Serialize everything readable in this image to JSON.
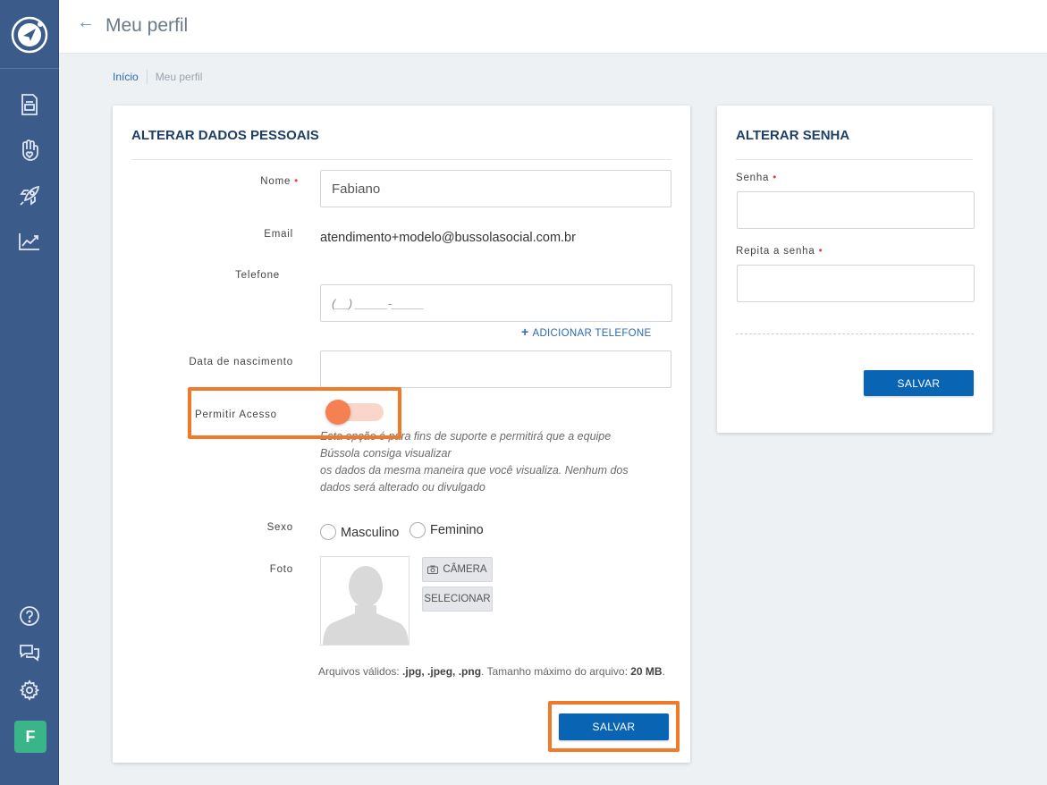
{
  "header": {
    "title": "Meu perfil"
  },
  "breadcrumb": {
    "home": "Início",
    "current": "Meu perfil"
  },
  "sidebar": {
    "items": [
      "document-icon",
      "hand-heart-icon",
      "rocket-icon",
      "chart-icon"
    ],
    "bottom": [
      "help-icon",
      "chat-icon",
      "gear-icon"
    ],
    "avatar_initial": "F",
    "avatar_color": "#3ab58a"
  },
  "personal": {
    "title": "ALTERAR DADOS PESSOAIS",
    "name_label": "Nome",
    "required_mark": "•",
    "name_value": "Fabiano",
    "email_label": "Email",
    "email_value": "atendimento+modelo@bussolasocial.com.br",
    "phone_label": "Telefone",
    "phone_placeholder": "(__) _____-_____",
    "add_phone": "ADICIONAR TELEFONE",
    "birth_label": "Data de nascimento",
    "birth_value": "",
    "access_label": "Permitir Acesso",
    "access_enabled": true,
    "access_help": [
      "Esta opção é para fins de suporte e permitirá que a equipe",
      "Bússola consiga visualizar",
      "os dados da mesma maneira que você visualiza. Nenhum dos",
      "dados será alterado ou divulgado"
    ],
    "sex_label": "Sexo",
    "sex_options": [
      "Masculino",
      "Feminino"
    ],
    "photo_label": "Foto",
    "camera_button": "CÂMERA",
    "select_button": "SELECIONAR",
    "file_note_prefix": "Arquivos válidos: ",
    "file_types": ".jpg, .jpeg, .png",
    "file_note_mid": ". Tamanho máximo do arquivo: ",
    "file_max": "20 MB",
    "file_note_end": ".",
    "save_button": "SALVAR"
  },
  "password": {
    "title": "ALTERAR SENHA",
    "password_label": "Senha",
    "repeat_label": "Repita a senha",
    "save_button": "SALVAR"
  },
  "colors": {
    "sidebar": "#3b5b8a",
    "primary": "#0a64b4",
    "highlight": "#f07a28",
    "toggle": "#f58052"
  }
}
